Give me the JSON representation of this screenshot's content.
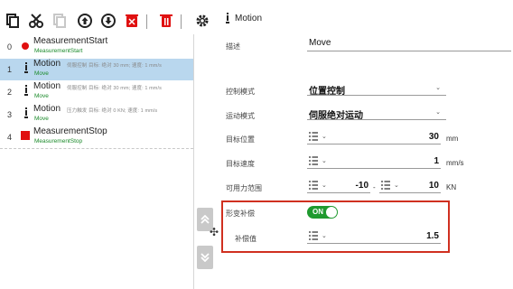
{
  "toolbar": {
    "buttons": [
      "copy-icon",
      "cut-icon",
      "paste-icon",
      "move-up-icon",
      "move-down-icon",
      "delete-cross-icon",
      "delete-icon",
      "settings-icon"
    ]
  },
  "tree": {
    "rows": [
      {
        "index": "0",
        "name": "MeasurementStart",
        "params": "",
        "sub": "MeasurementStart",
        "icon": "red-dot"
      },
      {
        "index": "1",
        "name": "Motion",
        "params": "伺服控制 目标: 绝对 30 mm; 速度: 1 mm/s",
        "sub": "Move",
        "icon": "motion",
        "selected": true
      },
      {
        "index": "2",
        "name": "Motion",
        "params": "伺服控制 目标: 绝对 30 mm; 速度: 1 mm/s",
        "sub": "Move",
        "icon": "motion"
      },
      {
        "index": "3",
        "name": "Motion",
        "params": "压力触发 目标: 绝对 0 KN; 速度: 1 mm/s",
        "sub": "Move",
        "icon": "motion"
      },
      {
        "index": "4",
        "name": "MeasurementStop",
        "params": "",
        "sub": "MeasurementStop",
        "icon": "red-square"
      }
    ]
  },
  "props": {
    "header": "Motion",
    "desc_label": "描述",
    "desc_value": "Move",
    "control_mode_label": "控制模式",
    "control_mode_value": "位置控制",
    "motion_mode_label": "运动模式",
    "motion_mode_value": "伺服绝对运动",
    "target_pos_label": "目标位置",
    "target_pos_value": "30",
    "target_pos_unit": "mm",
    "target_speed_label": "目标速度",
    "target_speed_value": "1",
    "target_speed_unit": "mm/s",
    "force_range_label": "可用力范围",
    "force_min": "-10",
    "force_sep": "-",
    "force_max": "10",
    "force_unit": "KN",
    "deform_label": "形变补偿",
    "deform_toggle": "ON",
    "comp_label": "补偿值",
    "comp_value": "1.5"
  }
}
